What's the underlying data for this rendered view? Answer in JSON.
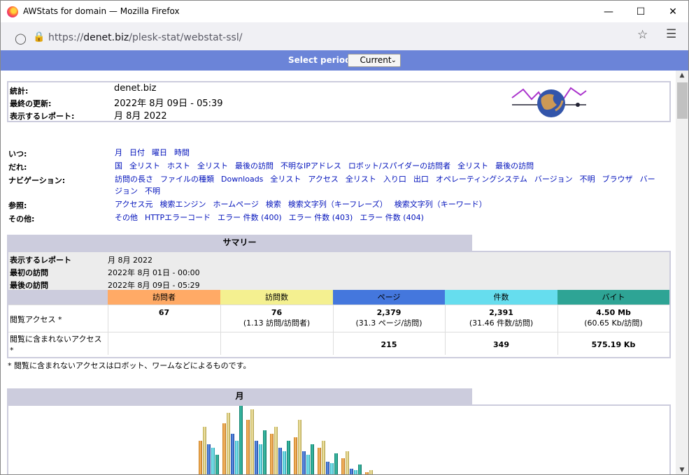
{
  "window": {
    "title": "AWStats for domain — Mozilla Firefox",
    "min_icon": "minimize-icon",
    "max_icon": "maximize-icon",
    "close_icon": "close-icon"
  },
  "browser": {
    "url_prefix": "https://",
    "url_host": "denet.biz",
    "url_path": "/plesk-stat/webstat-ssl/"
  },
  "period": {
    "label": "Select period",
    "selected": "Current"
  },
  "info": {
    "stats_label": "統計:",
    "stats_value": "denet.biz",
    "updated_label": "最終の更新:",
    "updated_value": "2022年 8月 09日 - 05:39",
    "report_label": "表示するレポート:",
    "report_value": "月 8月 2022"
  },
  "nav": [
    {
      "label": "いつ:",
      "links": [
        "月",
        "日付",
        "曜日",
        "時間"
      ]
    },
    {
      "label": "だれ:",
      "links": [
        "国",
        "全リスト",
        "ホスト",
        "全リスト",
        "最後の訪問",
        "不明なIPアドレス",
        "ロボット/スパイダーの訪問者",
        "全リスト",
        "最後の訪問"
      ]
    },
    {
      "label": "ナビゲーション:",
      "links": [
        "訪問の長さ",
        "ファイルの種類",
        "Downloads",
        "全リスト",
        "アクセス",
        "全リスト",
        "入り口",
        "出口",
        "オペレーティングシステム",
        "バージョン",
        "不明",
        "ブラウザ",
        "バージョン",
        "不明"
      ]
    },
    {
      "label": "参照:",
      "links": [
        "アクセス元",
        "検索エンジン",
        "ホームページ",
        "検索",
        "検索文字列（キーフレーズ）",
        "検索文字列（キーワード）"
      ]
    },
    {
      "label": "その他:",
      "links": [
        "その他",
        "HTTPエラーコード",
        "エラー 件数 (400)",
        "エラー 件数 (403)",
        "エラー 件数 (404)"
      ]
    }
  ],
  "summary": {
    "title": "サマリー",
    "report_label": "表示するレポート",
    "report_value": "月 8月 2022",
    "first_label": "最初の訪問",
    "first_value": "2022年 8月 01日 - 00:00",
    "last_label": "最後の訪問",
    "last_value": "2022年 8月 09日 - 05:29",
    "columns": [
      {
        "label": "訪問者",
        "color": "#ffaa66"
      },
      {
        "label": "訪問数",
        "color": "#f4f090"
      },
      {
        "label": "ページ",
        "color": "#4477dd"
      },
      {
        "label": "件数",
        "color": "#66ddee"
      },
      {
        "label": "バイト",
        "color": "#2ea495"
      }
    ],
    "viewed_label": "閲覧アクセス *",
    "viewed": {
      "visitors": "67",
      "visits": "76",
      "visits_sub": "(1.13 訪問/訪問者)",
      "pages": "2,379",
      "pages_sub": "(31.3 ページ/訪問)",
      "hits": "2,391",
      "hits_sub": "(31.46 件数/訪問)",
      "bytes": "4.50 Mb",
      "bytes_sub": "(60.65 Kb/訪問)"
    },
    "notviewed_label": "閲覧に含まれないアクセス *",
    "notviewed": {
      "pages": "215",
      "hits": "349",
      "bytes": "575.19 Kb"
    },
    "footnote": "* 閲覧に含まれないアクセスはロボット、ワームなどによるものです。"
  },
  "month": {
    "title": "月"
  }
}
